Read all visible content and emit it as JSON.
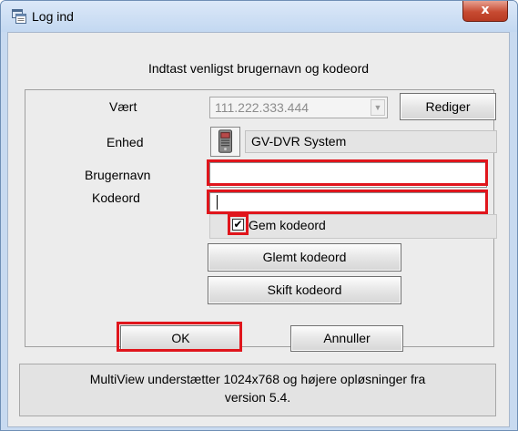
{
  "window": {
    "title": "Log ind",
    "close_label": "x"
  },
  "dialog": {
    "heading": "Indtast venligst brugernavn og kodeord",
    "host": {
      "label": "Vært",
      "value": "111.222.333.444",
      "edit_label": "Rediger"
    },
    "device": {
      "label": "Enhed",
      "value": "GV-DVR System"
    },
    "username": {
      "label": "Brugernavn",
      "value": ""
    },
    "password": {
      "label": "Kodeord",
      "value": ""
    },
    "remember": {
      "label": "Gem kodeord",
      "checked": true,
      "mark": "✔"
    },
    "forgot_label": "Glemt kodeord",
    "change_label": "Skift kodeord",
    "ok_label": "OK",
    "cancel_label": "Annuller",
    "info_line1": "MultiView understætter 1024x768 og højere opløsninger fra",
    "info_line2": "version 5.4."
  },
  "colors": {
    "highlight": "#e0151c",
    "close_button": "#c74b32"
  },
  "icons": [
    "window-app-icon",
    "dropdown-arrow-icon",
    "dvr-device-icon",
    "checkmark-icon"
  ]
}
